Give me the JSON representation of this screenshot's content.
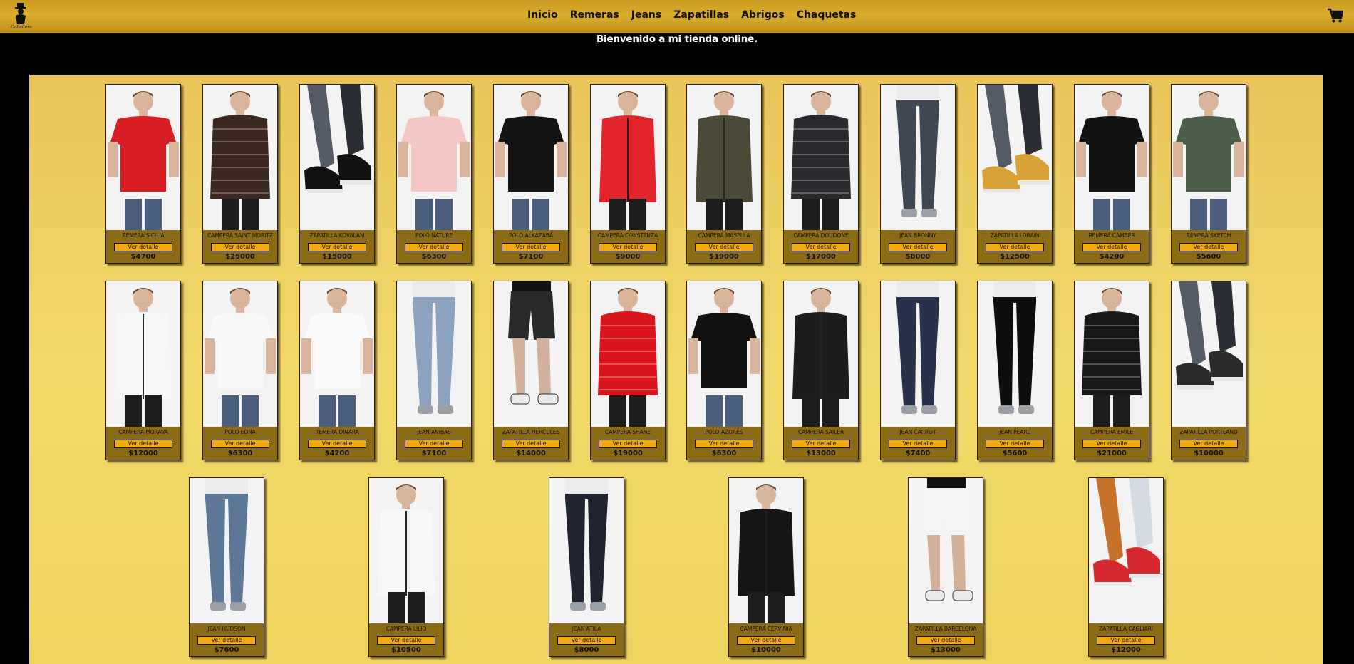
{
  "header": {
    "logo_text": "Caballero",
    "nav": [
      "Inicio",
      "Remeras",
      "Jeans",
      "Zapatillas",
      "Abrigos",
      "Chaquetas"
    ],
    "cart_icon": "cart-icon"
  },
  "welcome": "Bienvenido a mi tienda online.",
  "colors": {
    "header_gold": "#d9ab2a",
    "panel_gold": "#efd35f",
    "card_brown": "#8c6b17",
    "button_orange": "#f0a90f"
  },
  "products": [
    {
      "name": "REMERA SICILIA",
      "button": "Ver detalle",
      "price": "$4700",
      "kind": "tee",
      "color": "#d81e25"
    },
    {
      "name": "CAMPERA SAINT MORITZ",
      "button": "Ver detalle",
      "price": "$25000",
      "kind": "puffer",
      "color": "#3b2a1f"
    },
    {
      "name": "ZAPATILLA KOVALAM",
      "button": "Ver detalle",
      "price": "$15000",
      "kind": "shoe",
      "color": "#111111"
    },
    {
      "name": "POLO NATURE",
      "button": "Ver detalle",
      "price": "$6300",
      "kind": "tee",
      "color": "#f3c8c4"
    },
    {
      "name": "POLO ALKAZABA",
      "button": "Ver detalle",
      "price": "$7100",
      "kind": "tee",
      "color": "#141414"
    },
    {
      "name": "CAMPERA CONSTANZA",
      "button": "Ver detalle",
      "price": "$9000",
      "kind": "jacket",
      "color": "#e2242c"
    },
    {
      "name": "CAMPERA MASELLA",
      "button": "Ver detalle",
      "price": "$19000",
      "kind": "jacket",
      "color": "#4a4a36"
    },
    {
      "name": "CAMPERA DOUDONE",
      "button": "Ver detalle",
      "price": "$17000",
      "kind": "puffer",
      "color": "#2a2a2e"
    },
    {
      "name": "JEAN BRONNY",
      "button": "Ver detalle",
      "price": "$8000",
      "kind": "jean",
      "color": "#3f4654"
    },
    {
      "name": "ZAPATILLA LORAIN",
      "button": "Ver detalle",
      "price": "$12500",
      "kind": "shoe",
      "color": "#d9a238"
    },
    {
      "name": "REMERA CAMBER",
      "button": "Ver detalle",
      "price": "$4200",
      "kind": "tee",
      "color": "#121212"
    },
    {
      "name": "REMERA SKETCH",
      "button": "Ver detalle",
      "price": "$5600",
      "kind": "tee",
      "color": "#4a5e48"
    },
    {
      "name": "CAMPERA MORAVA",
      "button": "Ver detalle",
      "price": "$12000",
      "kind": "jacket",
      "color": "#f6f6f6"
    },
    {
      "name": "POLO EDNA",
      "button": "Ver detalle",
      "price": "$6300",
      "kind": "tee",
      "color": "#f8f8f8"
    },
    {
      "name": "REMERA DINARA",
      "button": "Ver detalle",
      "price": "$4200",
      "kind": "tee",
      "color": "#fafafa"
    },
    {
      "name": "JEAN ANIBAS",
      "button": "Ver detalle",
      "price": "$7100",
      "kind": "jean",
      "color": "#8ba3bf"
    },
    {
      "name": "ZAPATILLA HERCULES",
      "button": "Ver detalle",
      "price": "$14000",
      "kind": "shorts",
      "color": "#2a2a2a"
    },
    {
      "name": "CAMPERA SHANE",
      "button": "Ver detalle",
      "price": "$19000",
      "kind": "puffer",
      "color": "#d9141c"
    },
    {
      "name": "POLO AZORES",
      "button": "Ver detalle",
      "price": "$6300",
      "kind": "tee",
      "color": "#111111"
    },
    {
      "name": "CAMPERA SAILER",
      "button": "Ver detalle",
      "price": "$13000",
      "kind": "jacket",
      "color": "#1c1c1c"
    },
    {
      "name": "JEAN CARROT",
      "button": "Ver detalle",
      "price": "$7400",
      "kind": "jean",
      "color": "#28324a"
    },
    {
      "name": "JEAN PEARL",
      "button": "Ver detalle",
      "price": "$5600",
      "kind": "jean",
      "color": "#0e0e0e"
    },
    {
      "name": "CAMPERA EMILE",
      "button": "Ver detalle",
      "price": "$21000",
      "kind": "puffer",
      "color": "#181818"
    },
    {
      "name": "ZAPATILLA PORTLAND",
      "button": "Ver detalle",
      "price": "$10000",
      "kind": "shoe",
      "color": "#2b2b2b"
    },
    {
      "name": "JEAN HUDSON",
      "button": "Ver detalle",
      "price": "$7600",
      "kind": "jean",
      "color": "#5d7897"
    },
    {
      "name": "CAMPERA LILIO",
      "button": "Ver detalle",
      "price": "$10500",
      "kind": "jacket",
      "color": "#f7f7f7"
    },
    {
      "name": "JEAN ATILA",
      "button": "Ver detalle",
      "price": "$8000",
      "kind": "jean",
      "color": "#1f2430"
    },
    {
      "name": "CAMPERA CERVINIA",
      "button": "Ver detalle",
      "price": "$10000",
      "kind": "jacket",
      "color": "#161616"
    },
    {
      "name": "ZAPATILLA BARCELONA",
      "button": "Ver detalle",
      "price": "$13000",
      "kind": "shorts",
      "color": "#f4f4f4"
    },
    {
      "name": "ZAPATILLA CAGLIARI",
      "button": "Ver detalle",
      "price": "$12000",
      "kind": "shoe",
      "color": "#d42a2f"
    }
  ]
}
